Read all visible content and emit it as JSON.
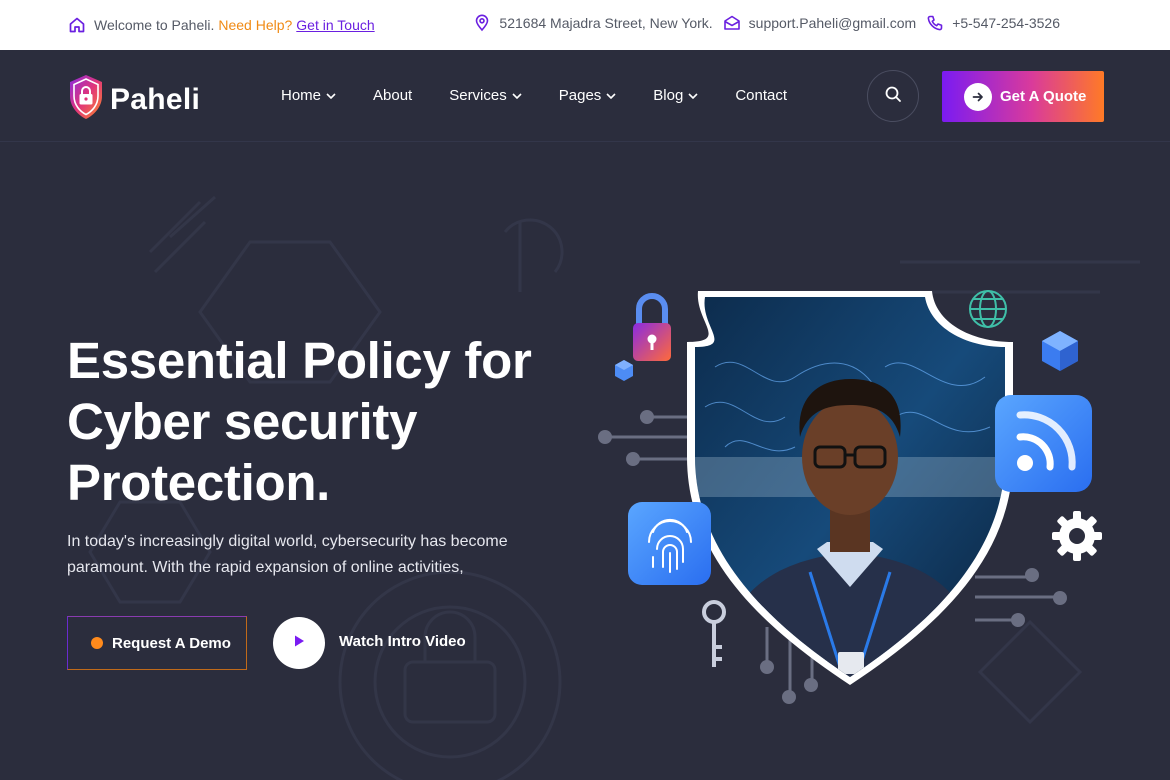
{
  "topbar": {
    "welcome": "Welcome to Paheli.",
    "help": "Need Help?",
    "contact_link": "Get in Touch",
    "address": "521684 Majadra Street, New York.",
    "email": "support.Paheli@gmail.com",
    "phone": "+5-547-254-3526"
  },
  "brand": {
    "name": "Paheli"
  },
  "nav": {
    "items": [
      {
        "label": "Home",
        "dropdown": true
      },
      {
        "label": "About",
        "dropdown": false
      },
      {
        "label": "Services",
        "dropdown": true
      },
      {
        "label": "Pages",
        "dropdown": true
      },
      {
        "label": "Blog",
        "dropdown": true
      },
      {
        "label": "Contact",
        "dropdown": false
      }
    ],
    "cta": "Get A Quote"
  },
  "hero": {
    "title_line1": "Essential Policy for",
    "title_line2": "Cyber security",
    "title_line3": "Protection.",
    "description": "In today's increasingly digital world, cybersecurity has become paramount. With the rapid expansion of online activities,",
    "primary_button": "Request A Demo",
    "video_label": "Watch Intro Video"
  },
  "colors": {
    "background": "#2b2d3d",
    "accent_purple": "#7a1bf2",
    "accent_orange": "#ff7a26",
    "topbar_bg": "#ffffff",
    "icon_purple": "#6a1fe0"
  },
  "icons": [
    "home-icon",
    "location-icon",
    "mail-icon",
    "phone-icon",
    "shield-lock-logo",
    "chevron-down-icon",
    "search-icon",
    "arrow-right-icon",
    "play-icon",
    "padlock-icon",
    "globe-icon",
    "rss-icon",
    "fingerprint-icon",
    "gear-icon",
    "key-icon",
    "cube-icon"
  ]
}
